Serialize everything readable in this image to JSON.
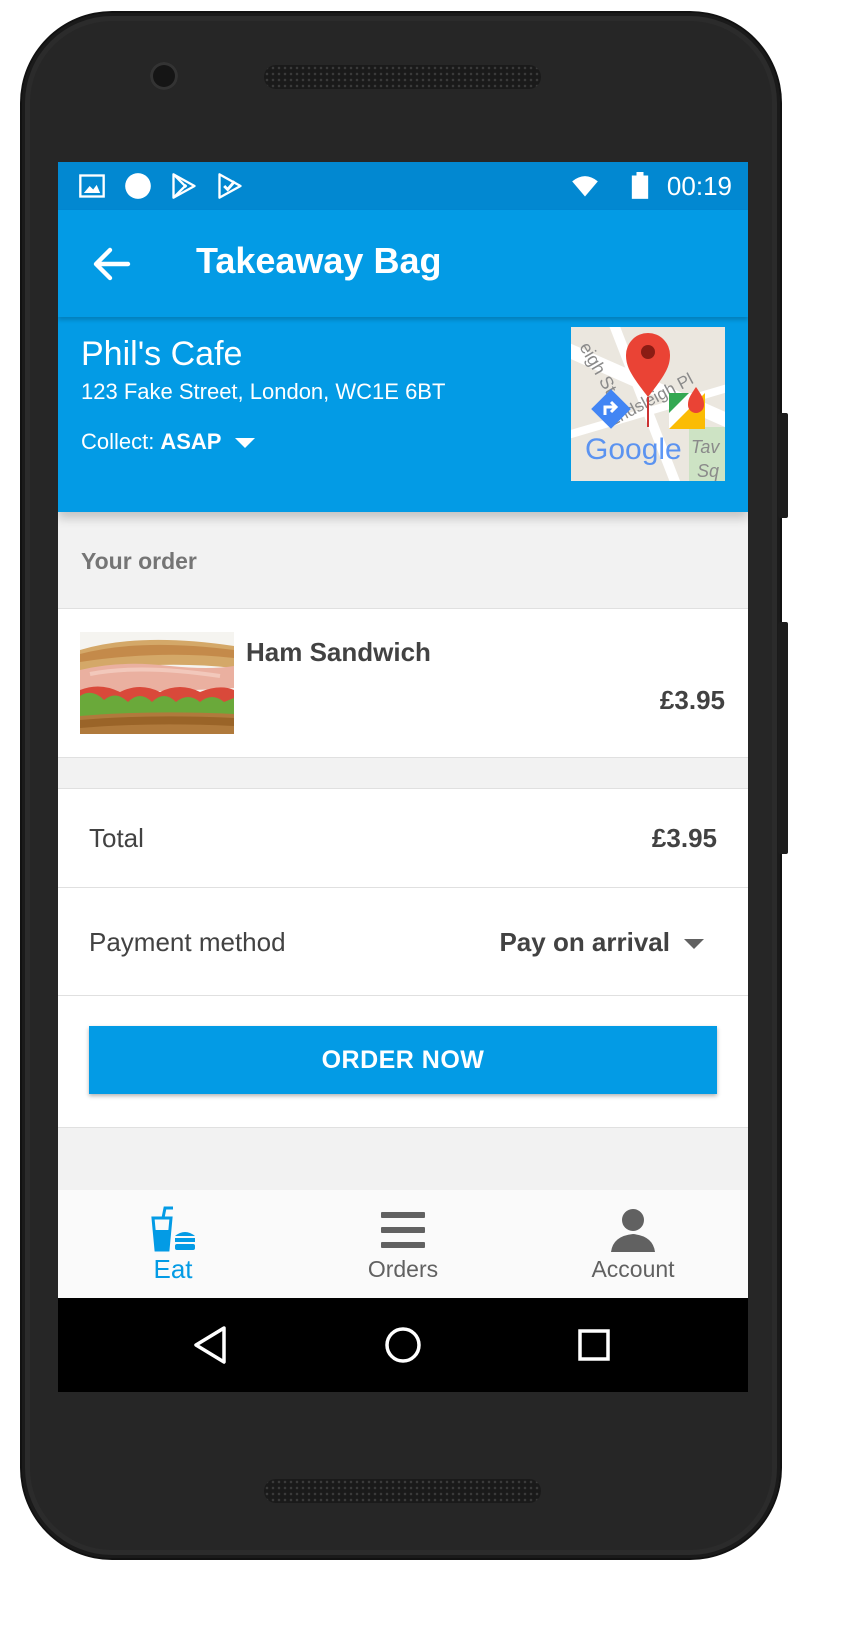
{
  "status_bar": {
    "time": "00:19",
    "icons": [
      "image-icon",
      "circle-icon",
      "play-store-icon",
      "task-check-icon",
      "wifi-icon",
      "battery-icon"
    ]
  },
  "app_bar": {
    "title": "Takeaway Bag",
    "back_icon": "arrow-left-icon"
  },
  "restaurant": {
    "name": "Phil's Cafe",
    "address": "123 Fake Street, London, WC1E 6BT",
    "collect_label": "Collect:",
    "collect_value": "ASAP",
    "map_brand": "Google",
    "map_streets": [
      "eigh St",
      "Endsleigh Pl",
      "Tav",
      "Sq"
    ]
  },
  "order": {
    "section_title": "Your order",
    "items": [
      {
        "name": "Ham Sandwich",
        "price": "£3.95"
      }
    ]
  },
  "summary": {
    "total_label": "Total",
    "total_value": "£3.95",
    "payment_label": "Payment method",
    "payment_value": "Pay on arrival",
    "order_button": "ORDER NOW"
  },
  "bottom_nav": {
    "items": [
      {
        "label": "Eat",
        "icon": "food-drink-icon",
        "active": true
      },
      {
        "label": "Orders",
        "icon": "menu-lines-icon",
        "active": false
      },
      {
        "label": "Account",
        "icon": "person-icon",
        "active": false
      }
    ]
  },
  "colors": {
    "primary": "#039be5",
    "primary_dark": "#0288d1",
    "text_dark": "#424242",
    "text_muted": "#757575"
  }
}
